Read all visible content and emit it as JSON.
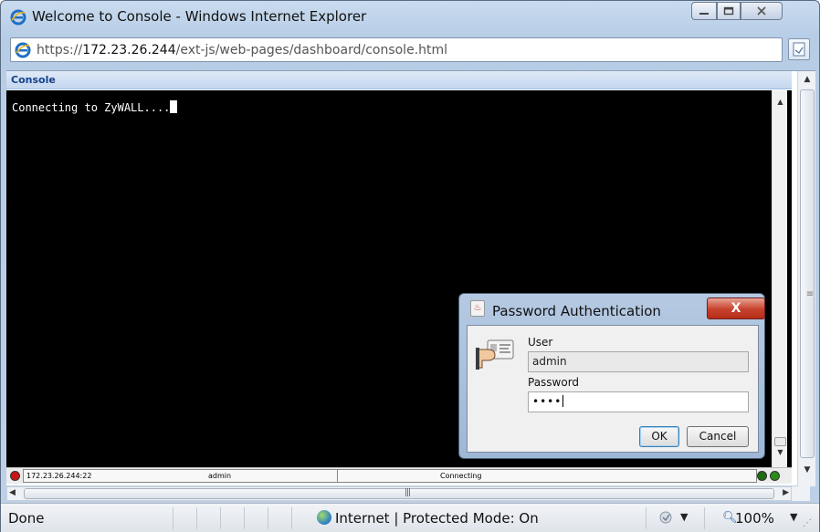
{
  "window": {
    "title": "Welcome to Console - Windows Internet Explorer"
  },
  "address": {
    "url_prefix": "https://",
    "url_host": "172.23.26.244",
    "url_path": "/ext-js/web-pages/dashboard/console.html"
  },
  "console": {
    "header": "Console",
    "output_line": "Connecting to ZyWALL...."
  },
  "java_status": {
    "host": "172.23.26.244:22",
    "user": "admin",
    "state": "Connecting"
  },
  "dialog": {
    "title": "Password Authentication",
    "user_label": "User",
    "user_value": "admin",
    "password_label": "Password",
    "password_mask": "••••",
    "ok_label": "OK",
    "cancel_label": "Cancel",
    "close_label": "X"
  },
  "statusbar": {
    "status": "Done",
    "zone": "Internet | Protected Mode: On",
    "zoom": "100%"
  },
  "colors": {
    "console_background": "#000000",
    "console_text": "#ffffff",
    "close_button": "#c7412c",
    "header_text": "#15428b"
  }
}
